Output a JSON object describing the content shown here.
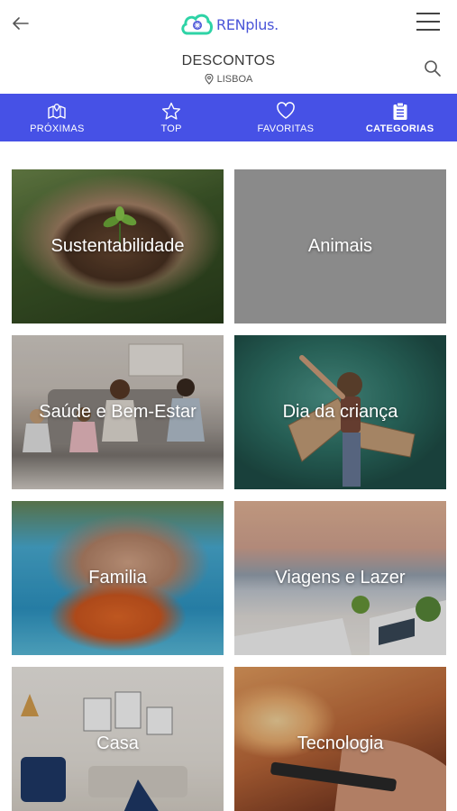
{
  "app": {
    "logo_text": "RENplus.",
    "brand_color": "#4651e6"
  },
  "header": {
    "title": "DESCONTOS",
    "location": "LISBOA"
  },
  "tabs": [
    {
      "label": "PRÓXIMAS",
      "icon": "map-icon",
      "active": false
    },
    {
      "label": "TOP",
      "icon": "star-icon",
      "active": false
    },
    {
      "label": "FAVORITAS",
      "icon": "heart-icon",
      "active": false
    },
    {
      "label": "CATEGORIAS",
      "icon": "clipboard-icon",
      "active": true
    }
  ],
  "categories": [
    {
      "label": "Sustentabilidade",
      "image": "hands-holding-plant"
    },
    {
      "label": "Animais",
      "image": "plain-gray"
    },
    {
      "label": "Saúde e Bem-Estar",
      "image": "family-meditating"
    },
    {
      "label": "Dia da criança",
      "image": "child-with-cardboard-wings"
    },
    {
      "label": "Familia",
      "image": "family-in-pool"
    },
    {
      "label": "Viagens e Lazer",
      "image": "seaside-terrace"
    },
    {
      "label": "Casa",
      "image": "living-room"
    },
    {
      "label": "Tecnologia",
      "image": "hand-with-phone-sunset"
    }
  ]
}
